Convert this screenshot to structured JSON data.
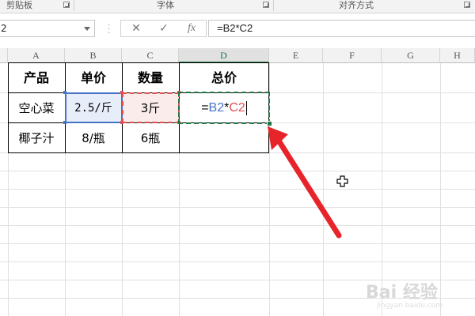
{
  "ribbon": {
    "groups": [
      "剪贴板",
      "字体",
      "对齐方式"
    ]
  },
  "formula_bar": {
    "name_box": "2",
    "cancel_icon": "✕",
    "enter_icon": "✓",
    "fx_label": "fx",
    "formula": "=B2*C2"
  },
  "columns": [
    "A",
    "B",
    "C",
    "D",
    "E",
    "F",
    "G",
    "H"
  ],
  "selected_column": "D",
  "table": {
    "headers": [
      "产品",
      "单价",
      "数量",
      "总价"
    ],
    "rows": [
      [
        "空心菜",
        "2.5/斤",
        "3斤",
        ""
      ],
      [
        "椰子汁",
        "8/瓶",
        "6瓶",
        ""
      ]
    ]
  },
  "editing_cell": {
    "equals": "=",
    "ref1": "B2",
    "op": "*",
    "ref2": "C2"
  },
  "colors": {
    "excel_green": "#217346",
    "ref_blue": "#4472c4",
    "ref_red": "#e05252",
    "arrow_red": "#e8242b"
  },
  "watermark": {
    "text": "Bai 经验",
    "sub": "jingyan.baidu.com"
  }
}
